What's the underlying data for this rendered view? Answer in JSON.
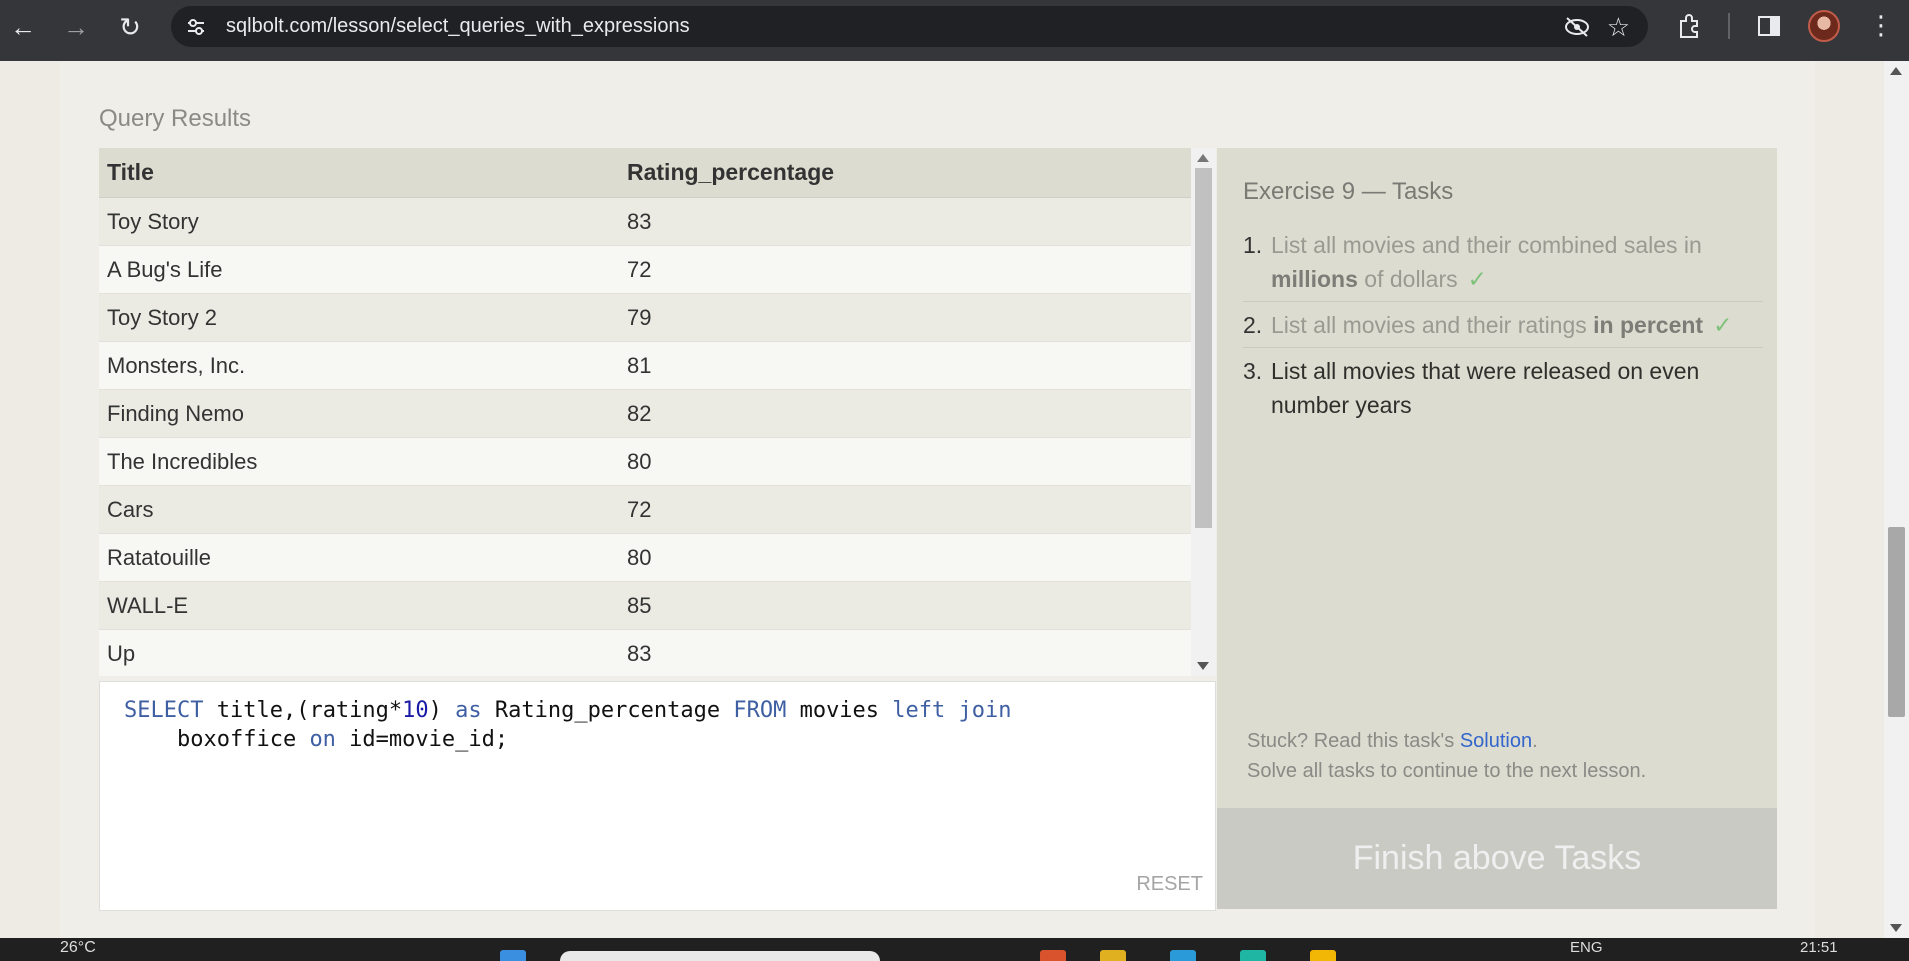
{
  "browser": {
    "url": "sqlbolt.com/lesson/select_queries_with_expressions"
  },
  "results": {
    "label": "Query Results",
    "columns": [
      "Title",
      "Rating_percentage"
    ],
    "rows": [
      [
        "Toy Story",
        "83"
      ],
      [
        "A Bug's Life",
        "72"
      ],
      [
        "Toy Story 2",
        "79"
      ],
      [
        "Monsters, Inc.",
        "81"
      ],
      [
        "Finding Nemo",
        "82"
      ],
      [
        "The Incredibles",
        "80"
      ],
      [
        "Cars",
        "72"
      ],
      [
        "Ratatouille",
        "80"
      ],
      [
        "WALL-E",
        "85"
      ],
      [
        "Up",
        "83"
      ]
    ]
  },
  "editor": {
    "code_line1": {
      "kw_select": "SELECT",
      "t1": " title,(rating*",
      "num": "10",
      "t2": ") ",
      "kw_as": "as",
      "t3": " Rating_percentage ",
      "kw_from": "FROM",
      "t4": " movies ",
      "kw_left": "left join"
    },
    "code_line2": {
      "t1": "    boxoffice ",
      "kw_on": "on",
      "t2": " id=movie_id;"
    },
    "reset_label": "RESET"
  },
  "tasks": {
    "title": "Exercise 9 — Tasks",
    "items": [
      {
        "num": "1.",
        "pre": "List all movies and their combined sales in ",
        "bold": "millions",
        "post": " of dollars",
        "check": "✓"
      },
      {
        "num": "2.",
        "pre": "List all movies and their ratings ",
        "bold": "in percent",
        "post": "",
        "check": "✓"
      },
      {
        "num": "3.",
        "text": "List all movies that were released on even number years"
      }
    ],
    "stuck_prefix": "Stuck? Read this task's ",
    "solution_link": "Solution",
    "stuck_suffix": ".",
    "solve_all": "Solve all tasks to continue to the next lesson.",
    "finish_button": "Finish above Tasks"
  },
  "taskbar": {
    "weather": "26°C",
    "lang": "ENG",
    "clock": "21:51"
  }
}
